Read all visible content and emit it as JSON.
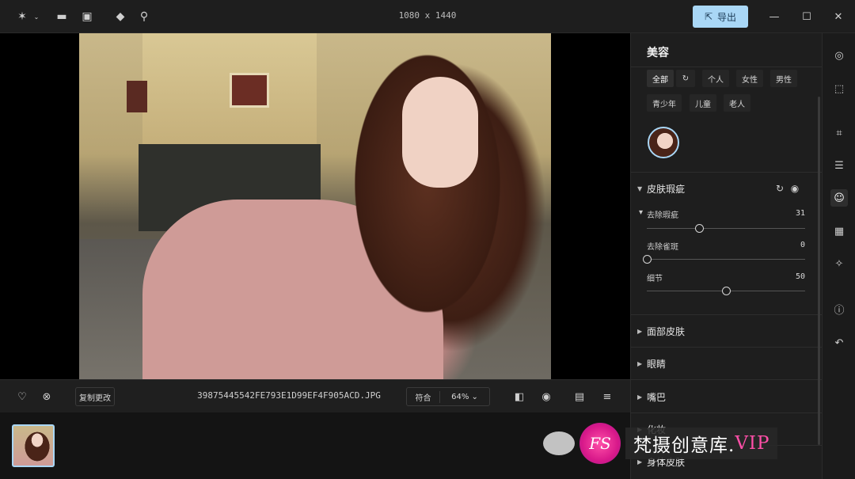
{
  "titlebar": {
    "title": "1080 x 1440",
    "export_label": "导出",
    "icons": [
      "sparkle-icon",
      "folder-icon",
      "image-import-icon",
      "eraser-icon",
      "magnifier-icon"
    ],
    "window_controls": [
      "minimize-icon",
      "maximize-icon",
      "close-icon"
    ]
  },
  "bottombar": {
    "copy_changes_label": "复制更改",
    "filename": "39875445542FE793E1D99EF4F905ACD.JPG",
    "fit_label": "符合",
    "zoom_label": "64% ⌄"
  },
  "panel": {
    "title": "美容",
    "filter_chips": [
      "全部",
      "个人",
      "女性",
      "男性",
      "青少年",
      "儿童",
      "老人"
    ],
    "sections": {
      "skin": {
        "title": "皮肤瑕疵",
        "sliders": [
          {
            "label": "去除瑕疵",
            "value": "31",
            "fraction": 0.33
          },
          {
            "label": "去除雀斑",
            "value": "0",
            "fraction": 0.0
          },
          {
            "label": "细节",
            "value": "50",
            "fraction": 0.5
          }
        ]
      },
      "collapsed": [
        "面部皮肤",
        "眼睛",
        "嘴巴",
        "化妆",
        "身体皮肤"
      ]
    }
  },
  "colors": {
    "accent": "#a9d7f6",
    "panel_bg": "#1e1e1e",
    "canvas_bg": "#000000"
  },
  "watermark": {
    "logo_text": "FS",
    "text_main": "梵摄创意库.",
    "text_vip": "VIP"
  }
}
